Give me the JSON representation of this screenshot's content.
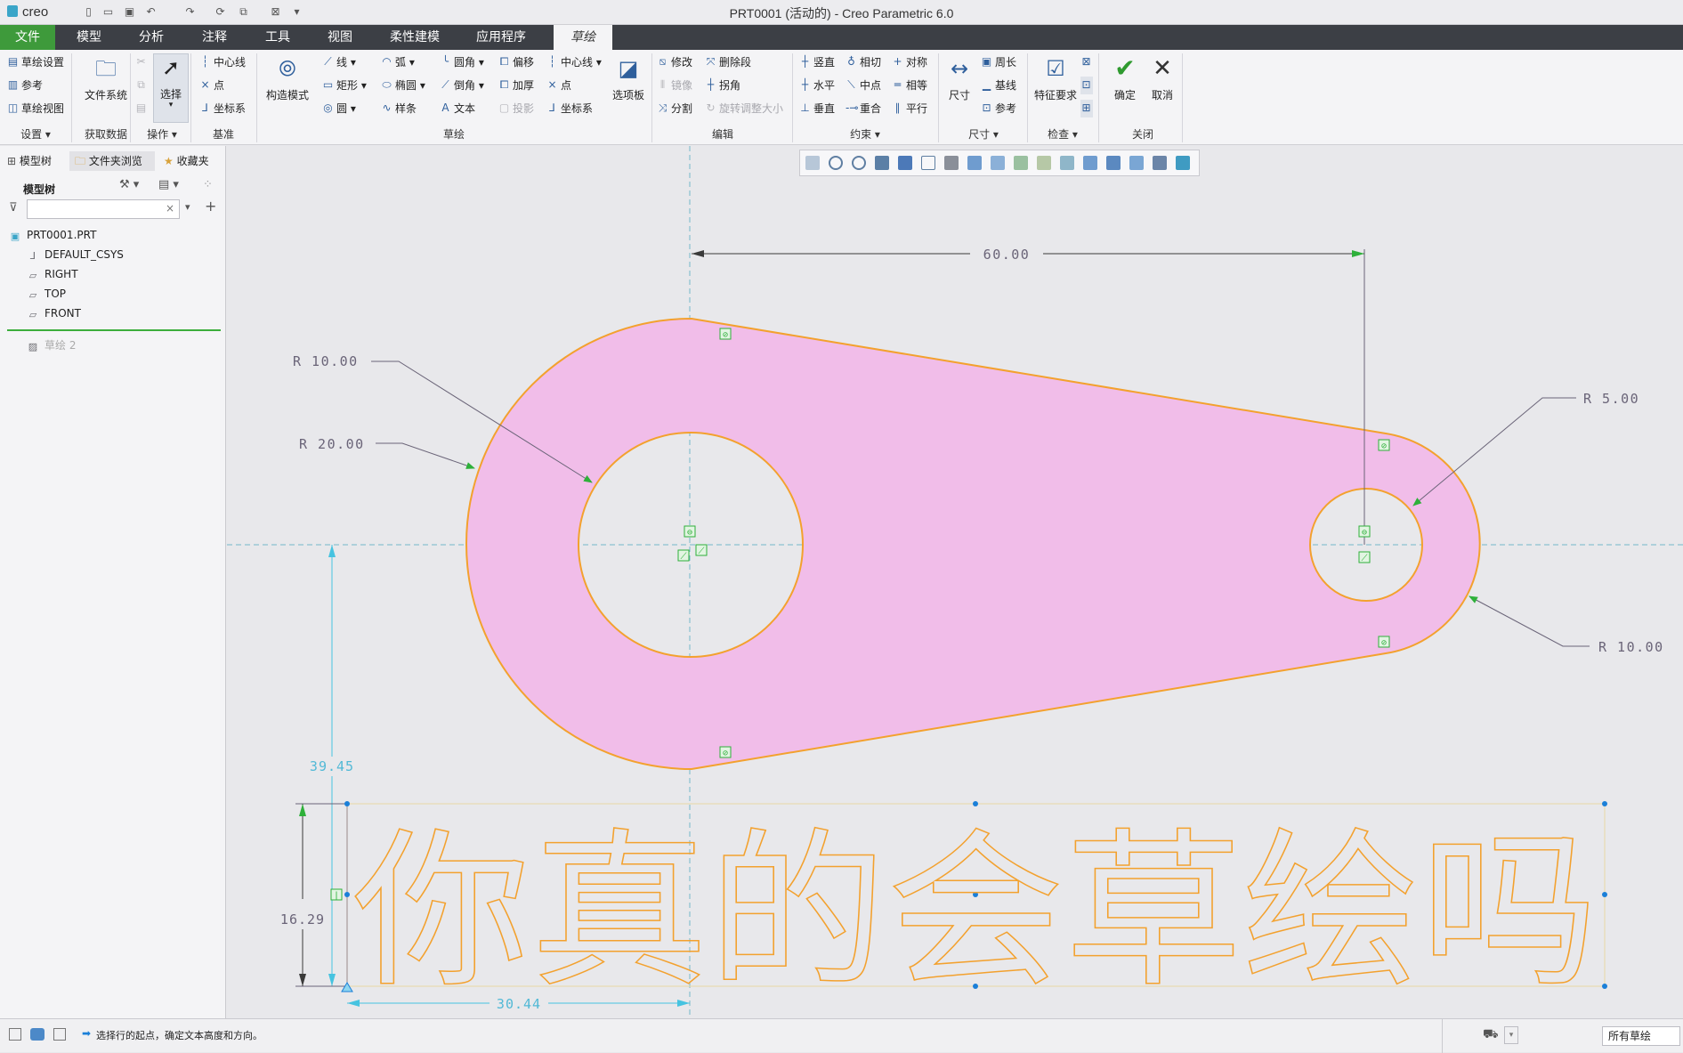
{
  "app": {
    "logo_text": "creo",
    "window_title": "PRT0001 (活动的) - Creo Parametric 6.0"
  },
  "menu": {
    "tabs": [
      "文件",
      "模型",
      "分析",
      "注释",
      "工具",
      "视图",
      "柔性建模",
      "应用程序",
      "草绘"
    ],
    "active_tab": "草绘"
  },
  "ribbon": {
    "setup": {
      "items": [
        "草绘设置",
        "参考",
        "草绘视图"
      ],
      "label": "设置"
    },
    "get_data": {
      "button": "文件系统",
      "label": "获取数据"
    },
    "operations": {
      "select": "选择",
      "label": "操作"
    },
    "datum": {
      "items": [
        "中心线",
        "点",
        "坐标系"
      ],
      "label": "基准"
    },
    "construction": {
      "button": "构造模式"
    },
    "sketching": {
      "col1": [
        "线",
        "矩形",
        "圆"
      ],
      "col2": [
        "弧",
        "椭圆",
        "样条"
      ],
      "col3": [
        "圆角",
        "倒角",
        "文本"
      ],
      "col4": [
        "偏移",
        "加厚",
        "投影"
      ],
      "col5": [
        "中心线",
        "点",
        "坐标系"
      ],
      "palette": "选项板",
      "label": "草绘"
    },
    "editing": {
      "col1": [
        "修改",
        "镜像",
        "分割"
      ],
      "col2": [
        "删除段",
        "拐角",
        "旋转调整大小"
      ],
      "label": "编辑"
    },
    "constrain": {
      "col1": [
        "竖直",
        "水平",
        "垂直"
      ],
      "col2": [
        "相切",
        "中点",
        "重合"
      ],
      "col3": [
        "对称",
        "相等",
        "平行"
      ],
      "label": "约束"
    },
    "dimension": {
      "button": "尺寸",
      "items": [
        "周长",
        "基线",
        "参考"
      ],
      "label": "尺寸"
    },
    "inspect": {
      "button": "特征要求",
      "label": "检查"
    },
    "close": {
      "ok": "确定",
      "cancel": "取消",
      "label": "关闭"
    }
  },
  "left_panel": {
    "tabs": [
      "模型树",
      "文件夹浏览",
      "收藏夹"
    ],
    "header": "模型树",
    "tree": [
      {
        "label": "PRT0001.PRT",
        "icon": "part-icon"
      },
      {
        "label": "DEFAULT_CSYS",
        "icon": "csys-icon"
      },
      {
        "label": "RIGHT",
        "icon": "datum-plane-icon"
      },
      {
        "label": "TOP",
        "icon": "datum-plane-icon"
      },
      {
        "label": "FRONT",
        "icon": "datum-plane-icon"
      },
      {
        "label": "草绘 2",
        "icon": "sketch-icon"
      }
    ]
  },
  "sketch": {
    "dimensions": {
      "d_60": "60.00",
      "r_10_left": "R 10.00",
      "r_20": "R 20.00",
      "r_5": "R 5.00",
      "r_10_right": "R 10.00",
      "d_39": "39.45",
      "d_16": "16.29",
      "d_30": "30.44"
    },
    "text_entity": "你真的会草绘吗",
    "colors": {
      "fill": "#f1bde9",
      "outline": "#f3a12e",
      "dimension": "#6a6478",
      "weak_dim": "#52b9d6",
      "constraint": "#2eb03a"
    }
  },
  "status": {
    "message": "选择行的起点，确定文本高度和方向。",
    "filter_value": "所有草绘"
  }
}
